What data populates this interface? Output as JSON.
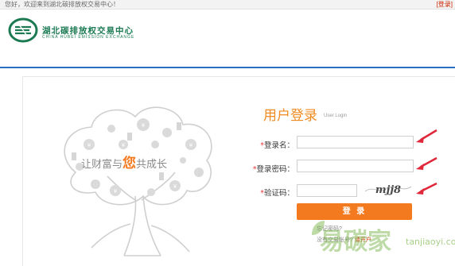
{
  "topbar": {
    "welcome": "您好，欢迎来到湖北碳排放权交易中心！",
    "login_link": "[登录]"
  },
  "logo": {
    "name_cn": "湖北碳排放权交易中心",
    "name_en": "CHINA HUBEI EMISSION EXCHANGE"
  },
  "banner": {
    "slogan_prefix": "让财富与",
    "slogan_highlight": "您",
    "slogan_suffix": "共成长"
  },
  "login": {
    "title": "用户登录",
    "title_en": "User Login",
    "username_star": "*",
    "username_label": "登录名：",
    "password_star": "*",
    "password_label": "登录密码：",
    "captcha_star": "*",
    "captcha_label": "验证码：",
    "captcha_text": "mjj8",
    "submit": "登 录",
    "forgot": "忘记密码?",
    "no_account": "没有交易帐号?",
    "open_account": "请开户"
  },
  "watermark": {
    "cn": "易碳家",
    "en": "tanjiaoyi.com"
  },
  "colors": {
    "brand_green": "#1b7a52",
    "accent_orange": "#f47a1f",
    "divider_blue": "#2a6fc4",
    "arrow_red": "#e0283a"
  }
}
